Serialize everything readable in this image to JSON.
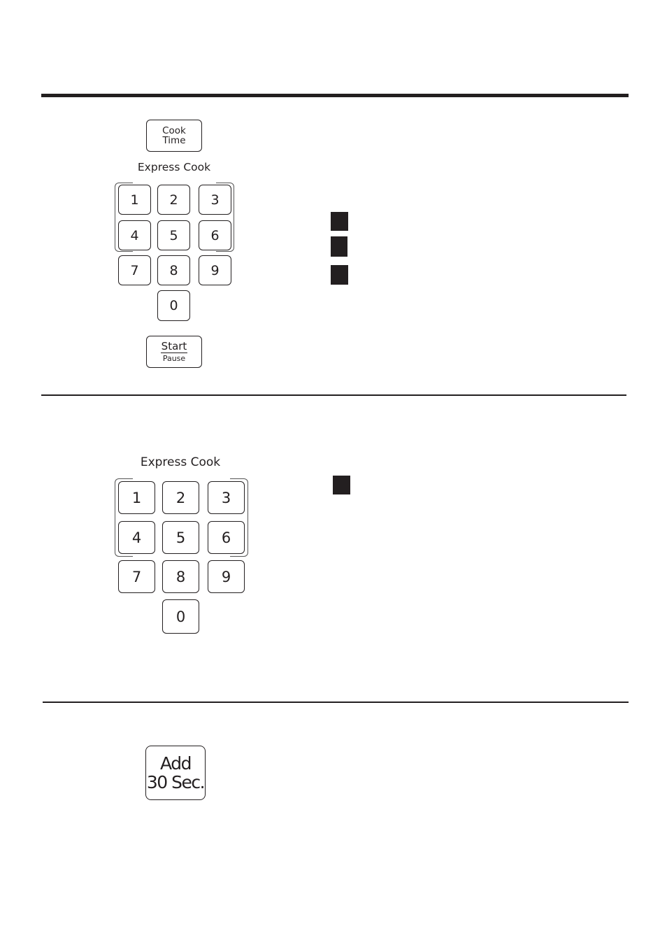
{
  "section1": {
    "cook_time_button": {
      "line1": "Cook",
      "line2": "Time"
    },
    "express_cook_label": "Express Cook",
    "keys": [
      "1",
      "2",
      "3",
      "4",
      "5",
      "6",
      "7",
      "8",
      "9",
      "0"
    ],
    "start_button": {
      "line1": "Start",
      "line2": "Pause"
    },
    "step_markers": 3
  },
  "section2": {
    "express_cook_label": "Express Cook",
    "keys": [
      "1",
      "2",
      "3",
      "4",
      "5",
      "6",
      "7",
      "8",
      "9",
      "0"
    ],
    "step_markers": 1
  },
  "section3": {
    "add_button": {
      "line1": "Add",
      "line2": "30 Sec."
    }
  },
  "colors": {
    "ink": "#231f20",
    "background": "#ffffff"
  }
}
